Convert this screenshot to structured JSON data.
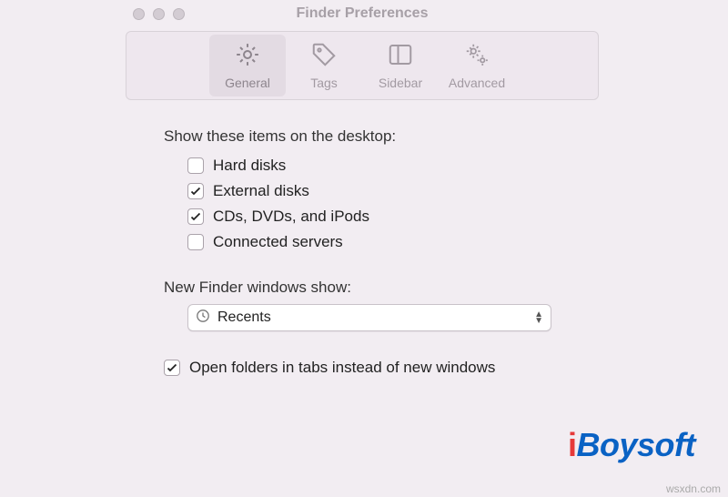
{
  "window": {
    "title": "Finder Preferences"
  },
  "toolbar": {
    "items": [
      {
        "label": "General",
        "icon": "gear-icon",
        "selected": true
      },
      {
        "label": "Tags",
        "icon": "tag-icon",
        "selected": false
      },
      {
        "label": "Sidebar",
        "icon": "sidebar-icon",
        "selected": false
      },
      {
        "label": "Advanced",
        "icon": "gears-icon",
        "selected": false
      }
    ]
  },
  "sections": {
    "desktop_items": {
      "label": "Show these items on the desktop:",
      "options": [
        {
          "label": "Hard disks",
          "checked": false
        },
        {
          "label": "External disks",
          "checked": true
        },
        {
          "label": "CDs, DVDs, and iPods",
          "checked": true
        },
        {
          "label": "Connected servers",
          "checked": false
        }
      ]
    },
    "new_windows": {
      "label": "New Finder windows show:",
      "selected": "Recents",
      "icon": "clock-icon"
    },
    "open_in_tabs": {
      "label": "Open folders in tabs instead of new windows",
      "checked": true
    }
  },
  "branding": {
    "watermark": "iBoysoft",
    "footer": "wsxdn.com"
  }
}
